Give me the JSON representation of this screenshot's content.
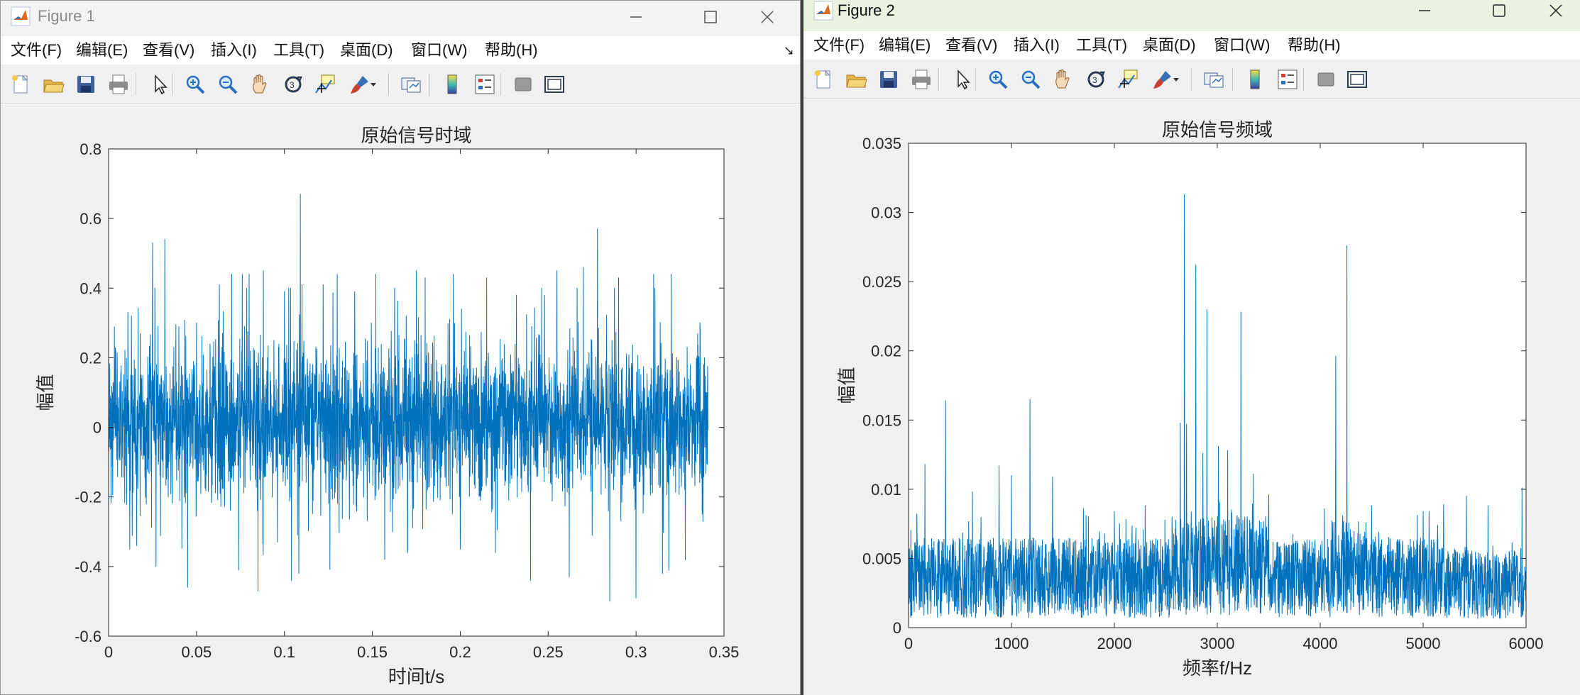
{
  "figure1": {
    "title": "Figure 1",
    "menus": [
      "文件(F)",
      "编辑(E)",
      "查看(V)",
      "插入(I)",
      "工具(T)",
      "桌面(D)",
      "窗口(W)",
      "帮助(H)"
    ],
    "toolbar": [
      "new-figure-icon",
      "open-file-icon",
      "save-icon",
      "print-icon",
      "pointer-icon",
      "zoom-in-icon",
      "zoom-out-icon",
      "pan-hand-icon",
      "rotate-3d-icon",
      "data-cursor-icon",
      "brush-icon",
      "link-plot-icon",
      "colorbar-icon",
      "legend-icon",
      "hide-plot-tools-icon",
      "show-plot-tools-icon"
    ],
    "chart_data": {
      "type": "line",
      "title": "原始信号时域",
      "xlabel": "时间t/s",
      "ylabel": "幅值",
      "xlim": [
        0,
        0.35
      ],
      "ylim": [
        -0.6,
        0.8
      ],
      "xticks": [
        "0",
        "0.05",
        "0.1",
        "0.15",
        "0.2",
        "0.25",
        "0.3",
        "0.35"
      ],
      "yticks": [
        "-0.6",
        "-0.4",
        "-0.2",
        "0",
        "0.2",
        "0.4",
        "0.6",
        "0.8"
      ],
      "color": "#0072bd",
      "grid": false,
      "series": [
        {
          "x_range": [
            0,
            0.341
          ],
          "description": "dense noisy vibration signal, ~4000 samples",
          "peaks": [
            [
              0.004,
              0.22
            ],
            [
              0.011,
              0.33
            ],
            [
              0.012,
              -0.35
            ],
            [
              0.013,
              0.32
            ],
            [
              0.016,
              -0.34
            ],
            [
              0.025,
              0.53
            ],
            [
              0.027,
              -0.4
            ],
            [
              0.032,
              0.54
            ],
            [
              0.04,
              0.29
            ],
            [
              0.045,
              -0.46
            ],
            [
              0.05,
              0.3
            ],
            [
              0.063,
              0.41
            ],
            [
              0.07,
              0.44
            ],
            [
              0.074,
              -0.41
            ],
            [
              0.076,
              0.44
            ],
            [
              0.08,
              0.44
            ],
            [
              0.085,
              -0.47
            ],
            [
              0.088,
              0.45
            ],
            [
              0.096,
              -0.33
            ],
            [
              0.1,
              0.39
            ],
            [
              0.104,
              -0.44
            ],
            [
              0.109,
              0.67
            ],
            [
              0.11,
              0.41
            ],
            [
              0.122,
              0.41
            ],
            [
              0.13,
              0.44
            ],
            [
              0.14,
              0.39
            ],
            [
              0.152,
              0.44
            ],
            [
              0.157,
              -0.38
            ],
            [
              0.17,
              -0.36
            ],
            [
              0.175,
              0.45
            ],
            [
              0.18,
              0.43
            ],
            [
              0.196,
              0.44
            ],
            [
              0.2,
              -0.35
            ],
            [
              0.215,
              0.43
            ],
            [
              0.22,
              -0.36
            ],
            [
              0.232,
              0.38
            ],
            [
              0.24,
              -0.44
            ],
            [
              0.255,
              0.45
            ],
            [
              0.262,
              -0.43
            ],
            [
              0.27,
              0.46
            ],
            [
              0.275,
              -0.31
            ],
            [
              0.278,
              0.57
            ],
            [
              0.285,
              -0.5
            ],
            [
              0.29,
              0.43
            ],
            [
              0.3,
              -0.49
            ],
            [
              0.31,
              0.44
            ],
            [
              0.315,
              -0.42
            ],
            [
              0.32,
              0.44
            ],
            [
              0.328,
              -0.38
            ],
            [
              0.335,
              0.27
            ],
            [
              0.338,
              -0.27
            ]
          ]
        }
      ]
    }
  },
  "figure2": {
    "title": "Figure 2",
    "menus": [
      "文件(F)",
      "编辑(E)",
      "查看(V)",
      "插入(I)",
      "工具(T)",
      "桌面(D)",
      "窗口(W)",
      "帮助(H)"
    ],
    "toolbar": [
      "new-figure-icon",
      "open-file-icon",
      "save-icon",
      "print-icon",
      "pointer-icon",
      "zoom-in-icon",
      "zoom-out-icon",
      "pan-hand-icon",
      "rotate-3d-icon",
      "data-cursor-icon",
      "brush-icon",
      "link-plot-icon",
      "colorbar-icon",
      "legend-icon",
      "hide-plot-tools-icon",
      "show-plot-tools-icon"
    ],
    "chart_data": {
      "type": "line",
      "title": "原始信号频域",
      "xlabel": "频率f/Hz",
      "ylabel": "幅值",
      "xlim": [
        0,
        6000
      ],
      "ylim": [
        0,
        0.035
      ],
      "xticks": [
        "0",
        "1000",
        "2000",
        "3000",
        "4000",
        "5000",
        "6000"
      ],
      "yticks": [
        "0",
        "0.005",
        "0.01",
        "0.015",
        "0.02",
        "0.025",
        "0.03",
        "0.035"
      ],
      "color": "#0072bd",
      "grid": false,
      "series": [
        {
          "x_range": [
            0,
            6000
          ],
          "description": "dense amplitude spectrum, noise floor ~0.001-0.008",
          "peaks": [
            [
              80,
              0.0082
            ],
            [
              160,
              0.0118
            ],
            [
              360,
              0.0164
            ],
            [
              620,
              0.0098
            ],
            [
              880,
              0.0117
            ],
            [
              1000,
              0.011
            ],
            [
              1180,
              0.0165
            ],
            [
              1400,
              0.0109
            ],
            [
              1700,
              0.0086
            ],
            [
              2000,
              0.0084
            ],
            [
              2300,
              0.0088
            ],
            [
              2640,
              0.0148
            ],
            [
              2680,
              0.0313
            ],
            [
              2700,
              0.0147
            ],
            [
              2790,
              0.0262
            ],
            [
              2860,
              0.0126
            ],
            [
              2900,
              0.023
            ],
            [
              3010,
              0.0131
            ],
            [
              3100,
              0.0128
            ],
            [
              3230,
              0.0228
            ],
            [
              3350,
              0.0111
            ],
            [
              3500,
              0.0096
            ],
            [
              4040,
              0.0086
            ],
            [
              4150,
              0.0196
            ],
            [
              4260,
              0.0276
            ],
            [
              4500,
              0.0088
            ],
            [
              5000,
              0.0084
            ],
            [
              5200,
              0.0089
            ],
            [
              5420,
              0.0095
            ],
            [
              5630,
              0.0088
            ],
            [
              5960,
              0.0101
            ]
          ]
        }
      ]
    }
  }
}
